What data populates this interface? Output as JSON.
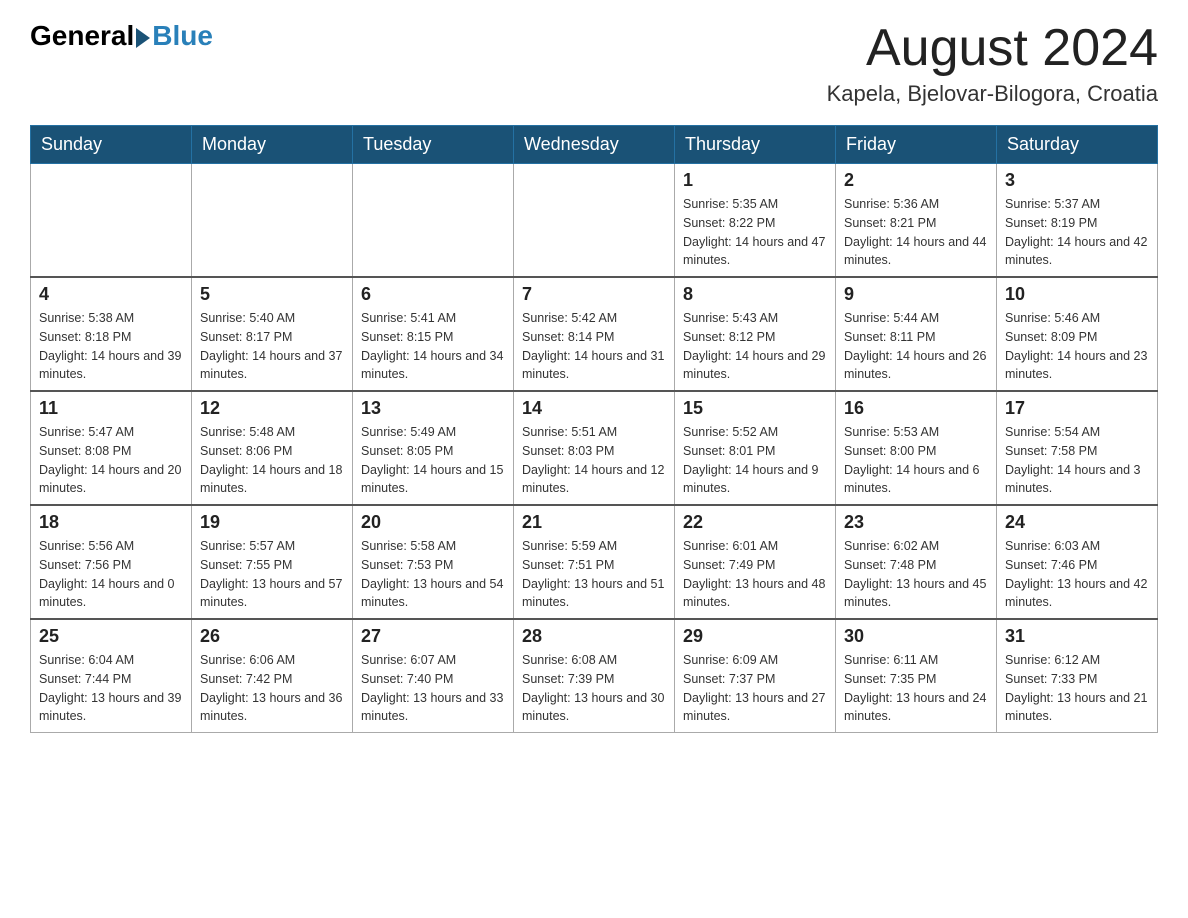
{
  "header": {
    "logo_general": "General",
    "logo_blue": "Blue",
    "month_year": "August 2024",
    "location": "Kapela, Bjelovar-Bilogora, Croatia"
  },
  "days_of_week": [
    "Sunday",
    "Monday",
    "Tuesday",
    "Wednesday",
    "Thursday",
    "Friday",
    "Saturday"
  ],
  "weeks": [
    [
      {
        "day": "",
        "info": ""
      },
      {
        "day": "",
        "info": ""
      },
      {
        "day": "",
        "info": ""
      },
      {
        "day": "",
        "info": ""
      },
      {
        "day": "1",
        "info": "Sunrise: 5:35 AM\nSunset: 8:22 PM\nDaylight: 14 hours and 47 minutes."
      },
      {
        "day": "2",
        "info": "Sunrise: 5:36 AM\nSunset: 8:21 PM\nDaylight: 14 hours and 44 minutes."
      },
      {
        "day": "3",
        "info": "Sunrise: 5:37 AM\nSunset: 8:19 PM\nDaylight: 14 hours and 42 minutes."
      }
    ],
    [
      {
        "day": "4",
        "info": "Sunrise: 5:38 AM\nSunset: 8:18 PM\nDaylight: 14 hours and 39 minutes."
      },
      {
        "day": "5",
        "info": "Sunrise: 5:40 AM\nSunset: 8:17 PM\nDaylight: 14 hours and 37 minutes."
      },
      {
        "day": "6",
        "info": "Sunrise: 5:41 AM\nSunset: 8:15 PM\nDaylight: 14 hours and 34 minutes."
      },
      {
        "day": "7",
        "info": "Sunrise: 5:42 AM\nSunset: 8:14 PM\nDaylight: 14 hours and 31 minutes."
      },
      {
        "day": "8",
        "info": "Sunrise: 5:43 AM\nSunset: 8:12 PM\nDaylight: 14 hours and 29 minutes."
      },
      {
        "day": "9",
        "info": "Sunrise: 5:44 AM\nSunset: 8:11 PM\nDaylight: 14 hours and 26 minutes."
      },
      {
        "day": "10",
        "info": "Sunrise: 5:46 AM\nSunset: 8:09 PM\nDaylight: 14 hours and 23 minutes."
      }
    ],
    [
      {
        "day": "11",
        "info": "Sunrise: 5:47 AM\nSunset: 8:08 PM\nDaylight: 14 hours and 20 minutes."
      },
      {
        "day": "12",
        "info": "Sunrise: 5:48 AM\nSunset: 8:06 PM\nDaylight: 14 hours and 18 minutes."
      },
      {
        "day": "13",
        "info": "Sunrise: 5:49 AM\nSunset: 8:05 PM\nDaylight: 14 hours and 15 minutes."
      },
      {
        "day": "14",
        "info": "Sunrise: 5:51 AM\nSunset: 8:03 PM\nDaylight: 14 hours and 12 minutes."
      },
      {
        "day": "15",
        "info": "Sunrise: 5:52 AM\nSunset: 8:01 PM\nDaylight: 14 hours and 9 minutes."
      },
      {
        "day": "16",
        "info": "Sunrise: 5:53 AM\nSunset: 8:00 PM\nDaylight: 14 hours and 6 minutes."
      },
      {
        "day": "17",
        "info": "Sunrise: 5:54 AM\nSunset: 7:58 PM\nDaylight: 14 hours and 3 minutes."
      }
    ],
    [
      {
        "day": "18",
        "info": "Sunrise: 5:56 AM\nSunset: 7:56 PM\nDaylight: 14 hours and 0 minutes."
      },
      {
        "day": "19",
        "info": "Sunrise: 5:57 AM\nSunset: 7:55 PM\nDaylight: 13 hours and 57 minutes."
      },
      {
        "day": "20",
        "info": "Sunrise: 5:58 AM\nSunset: 7:53 PM\nDaylight: 13 hours and 54 minutes."
      },
      {
        "day": "21",
        "info": "Sunrise: 5:59 AM\nSunset: 7:51 PM\nDaylight: 13 hours and 51 minutes."
      },
      {
        "day": "22",
        "info": "Sunrise: 6:01 AM\nSunset: 7:49 PM\nDaylight: 13 hours and 48 minutes."
      },
      {
        "day": "23",
        "info": "Sunrise: 6:02 AM\nSunset: 7:48 PM\nDaylight: 13 hours and 45 minutes."
      },
      {
        "day": "24",
        "info": "Sunrise: 6:03 AM\nSunset: 7:46 PM\nDaylight: 13 hours and 42 minutes."
      }
    ],
    [
      {
        "day": "25",
        "info": "Sunrise: 6:04 AM\nSunset: 7:44 PM\nDaylight: 13 hours and 39 minutes."
      },
      {
        "day": "26",
        "info": "Sunrise: 6:06 AM\nSunset: 7:42 PM\nDaylight: 13 hours and 36 minutes."
      },
      {
        "day": "27",
        "info": "Sunrise: 6:07 AM\nSunset: 7:40 PM\nDaylight: 13 hours and 33 minutes."
      },
      {
        "day": "28",
        "info": "Sunrise: 6:08 AM\nSunset: 7:39 PM\nDaylight: 13 hours and 30 minutes."
      },
      {
        "day": "29",
        "info": "Sunrise: 6:09 AM\nSunset: 7:37 PM\nDaylight: 13 hours and 27 minutes."
      },
      {
        "day": "30",
        "info": "Sunrise: 6:11 AM\nSunset: 7:35 PM\nDaylight: 13 hours and 24 minutes."
      },
      {
        "day": "31",
        "info": "Sunrise: 6:12 AM\nSunset: 7:33 PM\nDaylight: 13 hours and 21 minutes."
      }
    ]
  ]
}
